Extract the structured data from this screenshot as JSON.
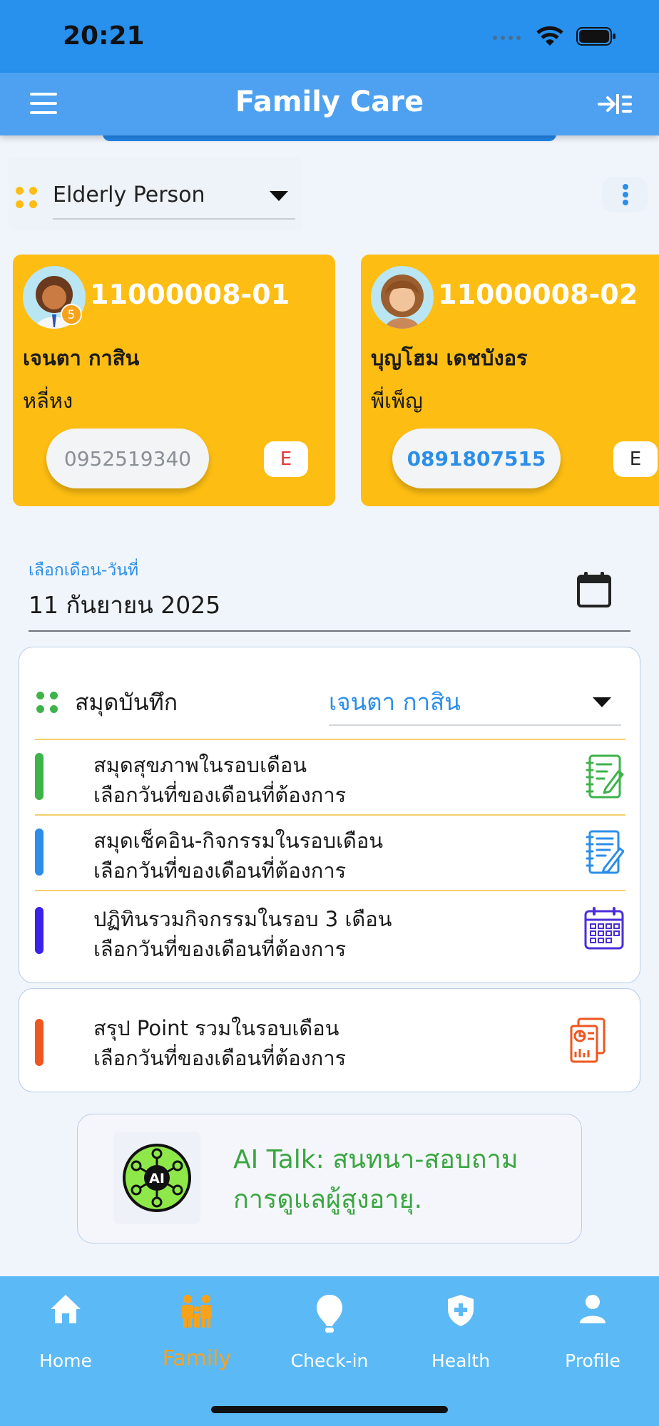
{
  "status_bar": {
    "time": "20:21"
  },
  "header": {
    "title": "Family Care"
  },
  "selector": {
    "label": "Elderly Person"
  },
  "members": [
    {
      "id": "11000008-01",
      "name": "เจนตา กาสิน",
      "nickname": "หลี่หง",
      "phone": "0952519340",
      "badge": "E",
      "avatar_badge": "5"
    },
    {
      "id": "11000008-02",
      "name": "บุญโฮม เดชบังอร",
      "nickname": "พี่เพ็ญ",
      "phone": "0891807515",
      "badge": "E"
    }
  ],
  "date": {
    "label": "เลือกเดือน-วันที่",
    "value": "11 กันยายน 2025"
  },
  "notebook": {
    "title": "สมุดบันทึก",
    "selected_member": "เจนตา กาสิน",
    "rows": [
      {
        "line1": "สมุดสุขภาพในรอบเดือน",
        "line2": "เลือกวันที่ของเดือนที่ต้องการ",
        "color": "#3eb34a",
        "icon": "health-notebook-icon"
      },
      {
        "line1": "สมุดเช็คอิน-กิจกรรมในรอบเดือน",
        "line2": "เลือกวันที่ของเดือนที่ต้องการ",
        "color": "#2b8ee8",
        "icon": "checkin-notebook-icon"
      },
      {
        "line1": "ปฏิทินรวมกิจกรรมในรอบ 3 เดือน",
        "line2": "เลือกวันที่ของเดือนที่ต้องการ",
        "color": "#3a22e6",
        "icon": "calendar-grid-icon"
      }
    ]
  },
  "points": {
    "line1": "สรุป Point รวมในรอบเดือน",
    "line2": "เลือกวันที่ของเดือนที่ต้องการ",
    "color": "#f0561f",
    "icon": "report-icon"
  },
  "ai": {
    "badge": "AI",
    "line1": "AI Talk: สนทนา-สอบถาม",
    "line2": "การดูแลผู้สูงอายุ."
  },
  "nav": [
    {
      "label": "Home",
      "icon": "home-icon",
      "active": false
    },
    {
      "label": "Family",
      "icon": "family-icon",
      "active": true
    },
    {
      "label": "Check-in",
      "icon": "location-pin-icon",
      "active": false
    },
    {
      "label": "Health",
      "icon": "health-shield-icon",
      "active": false
    },
    {
      "label": "Profile",
      "icon": "profile-icon",
      "active": false
    }
  ],
  "colors": {
    "header": "#4ea1f0",
    "status_bar": "#2891ee",
    "card": "#fdbd12",
    "accent": "#2b8ee8",
    "nav": "#5bb9f6",
    "nav_active": "#f7a21b",
    "ai_text": "#3aa641"
  }
}
